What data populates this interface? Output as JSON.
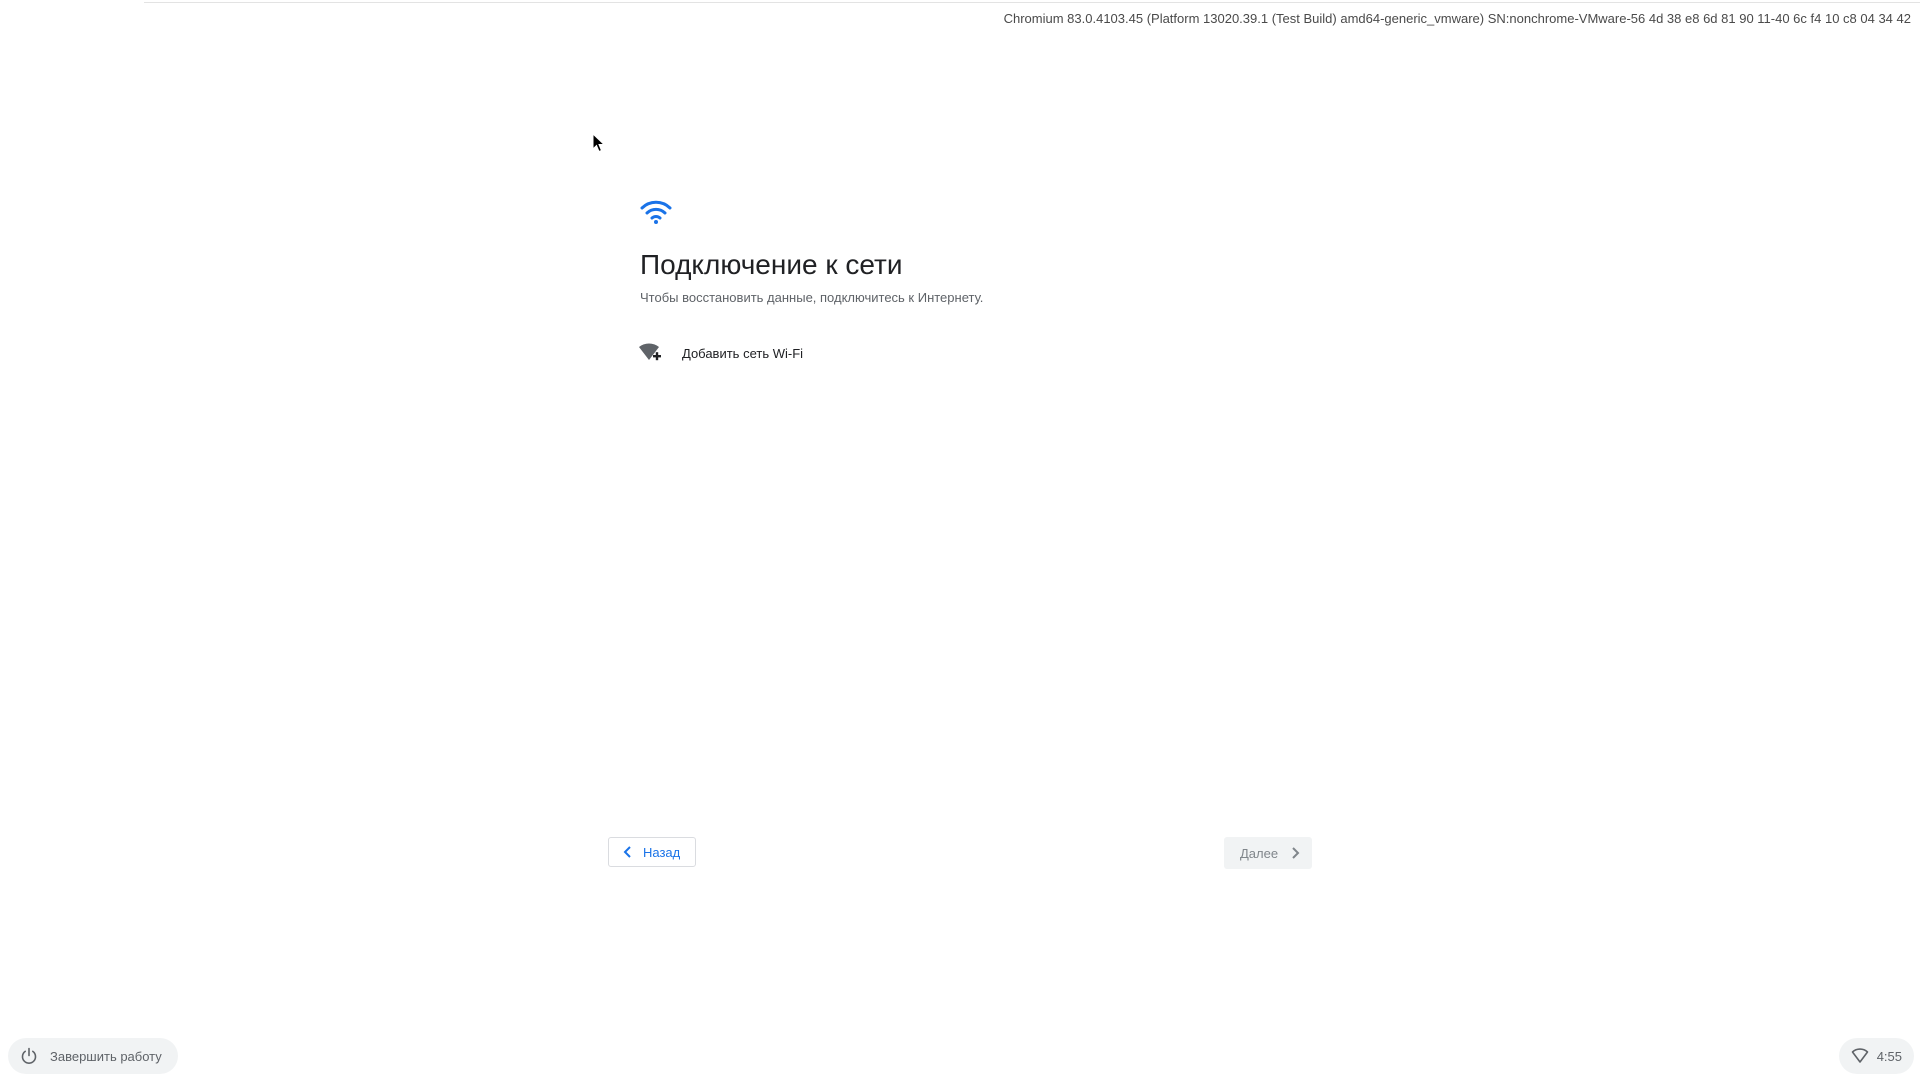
{
  "header": {
    "version_info": "Chromium 83.0.4103.45 (Platform 13020.39.1 (Test Build) amd64-generic_vmware) SN:nonchrome-VMware-56 4d 38 e8 6d 81 90 11-40 6c f4 10 c8 04 34 42"
  },
  "dialog": {
    "hero_icon": "wifi-icon",
    "title": "Подключение к сети",
    "subtitle": "Чтобы восстановить данные, подключитесь к Интернету.",
    "add_network": {
      "icon": "wifi-add-icon",
      "label": "Добавить сеть Wi-Fi"
    },
    "back_button": {
      "icon": "chevron-left-icon",
      "label": "Назад"
    },
    "next_button": {
      "icon": "chevron-right-icon",
      "label": "Далее",
      "enabled": false
    }
  },
  "shelf": {
    "shutdown_button": {
      "icon": "power-icon",
      "label": "Завершить работу"
    },
    "status_tray": {
      "icon": "network-icon",
      "time": "4:55"
    }
  },
  "colors": {
    "accent": "#1a73e8",
    "title_text": "#202124",
    "secondary_text": "#5f6368",
    "pill_background": "#f1f3f4"
  }
}
